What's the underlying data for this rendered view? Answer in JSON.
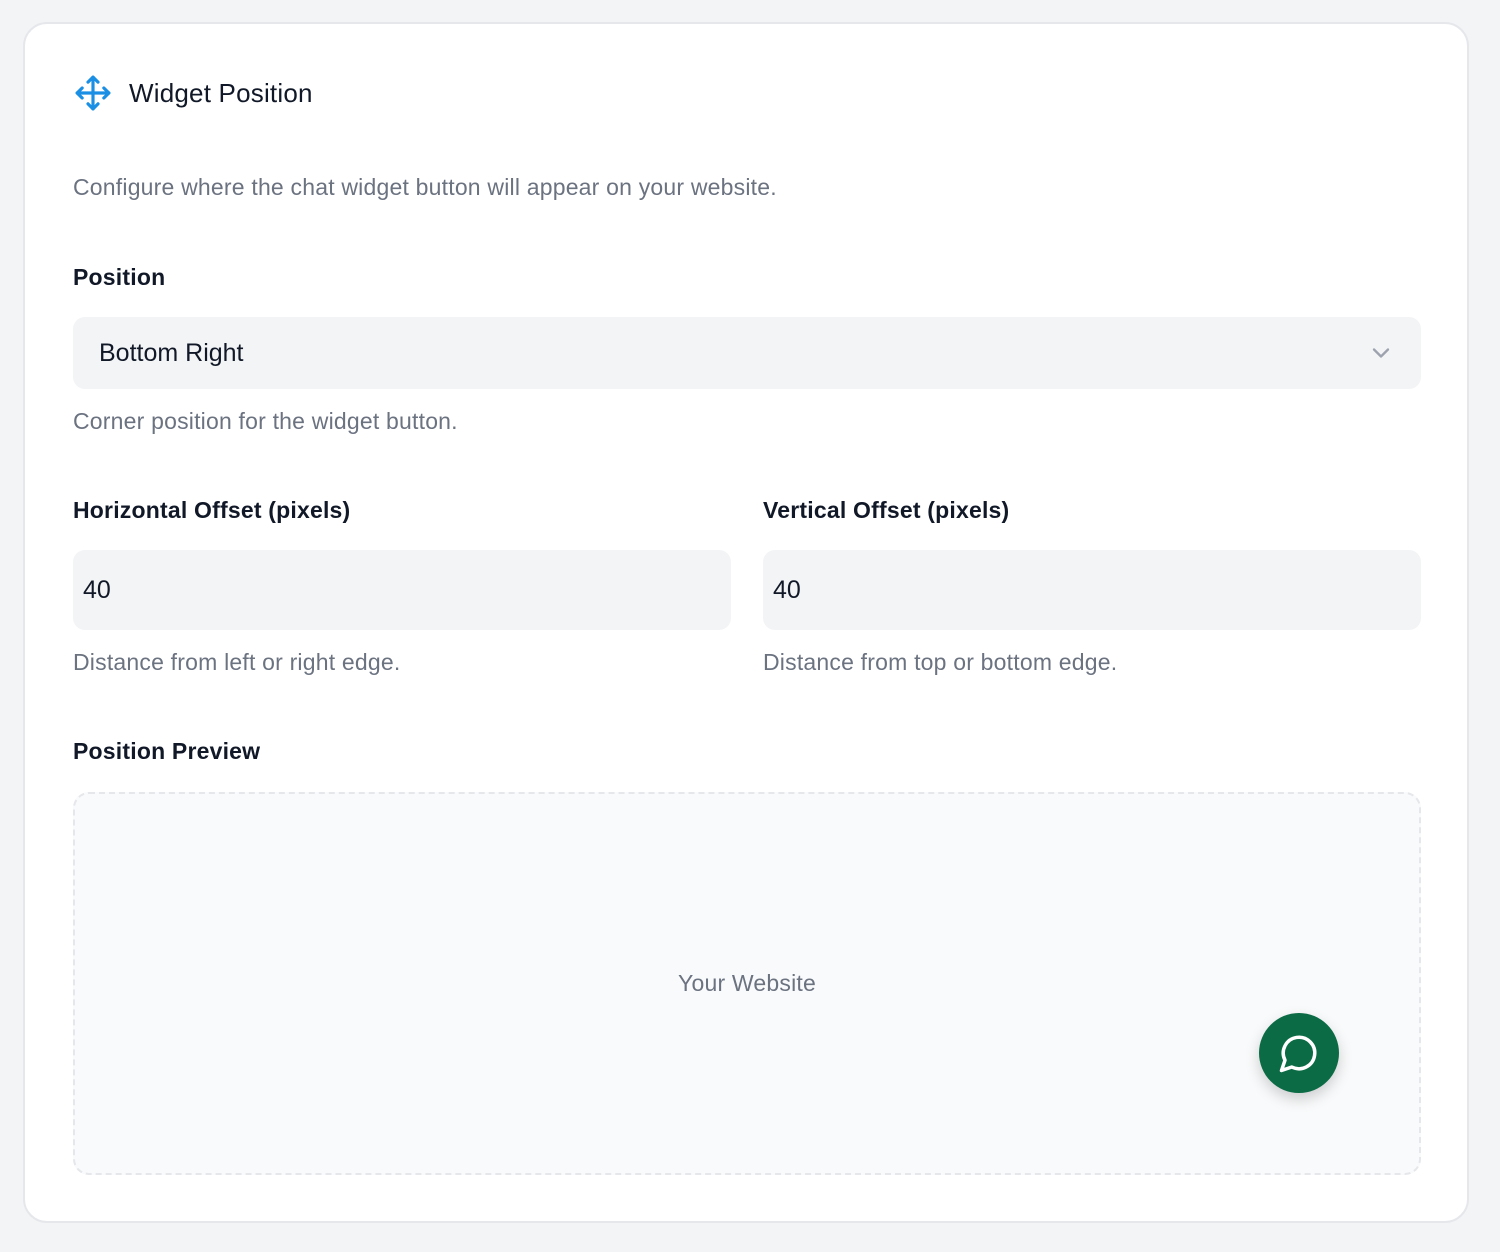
{
  "header": {
    "title": "Widget Position",
    "icon": "move-arrows-icon",
    "icon_color": "#1a8fe3"
  },
  "description": "Configure where the chat widget button will appear on your website.",
  "position": {
    "label": "Position",
    "selected": "Bottom Right",
    "helper": "Corner position for the widget button."
  },
  "horizontal_offset": {
    "label": "Horizontal Offset (pixels)",
    "value": "40",
    "helper": "Distance from left or right edge."
  },
  "vertical_offset": {
    "label": "Vertical Offset (pixels)",
    "value": "40",
    "helper": "Distance from top or bottom edge."
  },
  "preview": {
    "label": "Position Preview",
    "placeholder": "Your Website",
    "button_icon": "chat-bubble-icon",
    "button_color": "#0b6b45"
  }
}
